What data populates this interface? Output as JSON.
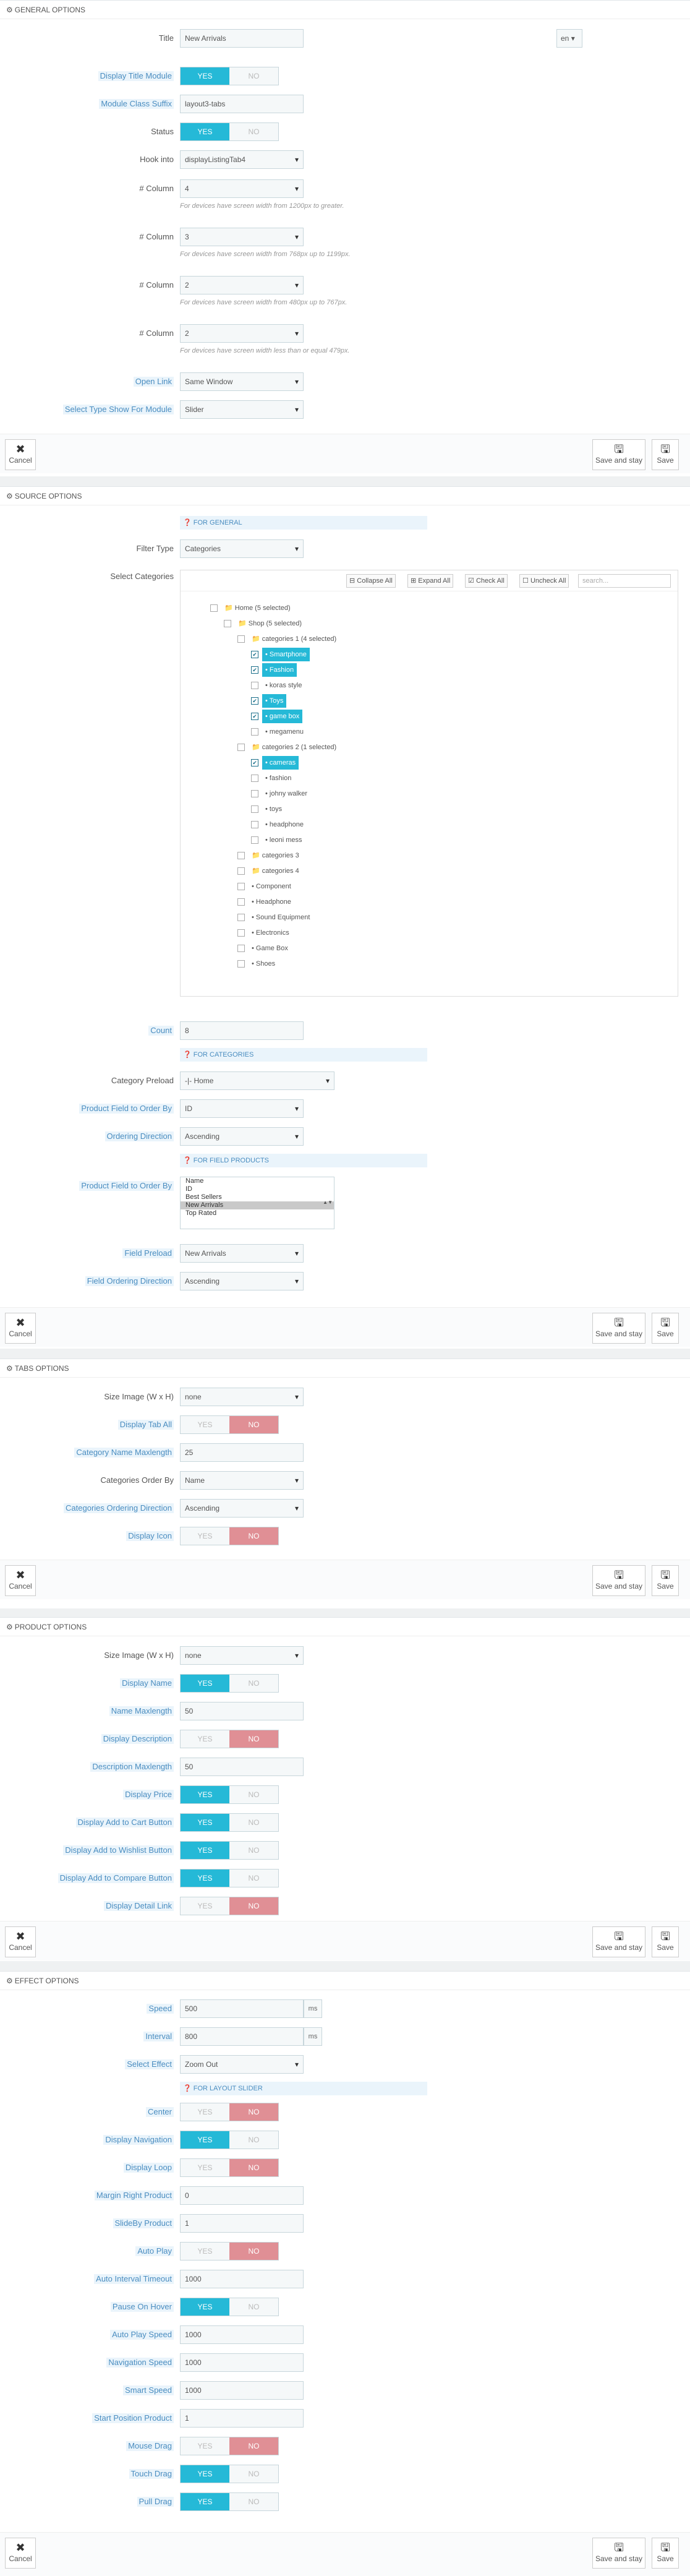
{
  "general": {
    "title": "General Options",
    "fields": {
      "title": "Title",
      "title_value": "New Arrivals",
      "lang": "en",
      "display_title": "Display Title Module",
      "suffix": "Module Class Suffix",
      "suffix_value": "layout3-tabs",
      "status": "Status",
      "hook": "Hook into",
      "hook_value": "displayListingTab4",
      "col1": "# Column",
      "col1_value": "4",
      "col1_help": "For devices have screen width from 1200px to greater.",
      "col2": "# Column",
      "col2_value": "3",
      "col2_help": "For devices have screen width from 768px up to 1199px.",
      "col3": "# Column",
      "col3_value": "2",
      "col3_help": "For devices have screen width from 480px up to 767px.",
      "col4": "# Column",
      "col4_value": "2",
      "col4_help": "For devices have screen width less than or equal 479px.",
      "open_link": "Open Link",
      "open_link_value": "Same Window",
      "type_show": "Select Type Show For Module",
      "type_show_value": "Slider"
    }
  },
  "common": {
    "yes": "YES",
    "no": "NO",
    "cancel": "Cancel",
    "save_stay": "Save and stay",
    "save": "Save"
  },
  "source": {
    "title": "Source Options",
    "for_general": "FOR GENERAL",
    "filter_type": "Filter Type",
    "filter_type_value": "Categories",
    "select_categories": "Select Categories",
    "collapse": "Collapse All",
    "expand": "Expand All",
    "check": "Check All",
    "uncheck": "Uncheck All",
    "search": "search...",
    "tree": [
      "Home (5 selected)",
      "Shop (5 selected)",
      "categories 1 (4 selected)",
      "Smartphone",
      "Fashion",
      "koras style",
      "Toys",
      "game box",
      "megamenu",
      "categories 2 (1 selected)",
      "cameras",
      "fashion",
      "johny walker",
      "toys",
      "headphone",
      "leoni mess",
      "categories 3",
      "categories 4",
      "Component",
      "Headphone",
      "Sound Equipment",
      "Electronics",
      "Game Box",
      "Shoes"
    ],
    "count": "Count",
    "count_value": "8",
    "for_categories": "FOR CATEGORIES",
    "cat_preload": "Category Preload",
    "cat_preload_value": "-|- Home",
    "field_order": "Product Field to Order By",
    "field_order_value": "ID",
    "order_dir": "Ordering Direction",
    "order_dir_value": "Ascending",
    "for_field": "FOR FIELD PRODUCTS",
    "field_order2": "Product Field to Order By",
    "list": [
      "Name",
      "ID",
      "Best Sellers",
      "New Arrivals",
      "Top Rated"
    ],
    "field_preload": "Field Preload",
    "field_preload_value": "New Arrivals",
    "field_order_dir": "Field Ordering Direction",
    "field_order_dir_value": "Ascending"
  },
  "tabs": {
    "title": "Tabs Options",
    "size_image": "Size Image (W x H)",
    "size_image_value": "none",
    "display_tab_all": "Display Tab All",
    "cat_maxlen": "Category Name Maxlength",
    "cat_maxlen_value": "25",
    "cat_order": "Categories Order By",
    "cat_order_value": "Name",
    "cat_order_dir": "Categories Ordering Direction",
    "cat_order_dir_value": "Ascending",
    "display_icon": "Display Icon"
  },
  "product": {
    "title": "Product Options",
    "size_image": "Size Image (W x H)",
    "size_image_value": "none",
    "display_name": "Display Name",
    "name_maxlen": "Name Maxlength",
    "name_maxlen_value": "50",
    "display_desc": "Display Description",
    "desc_maxlen": "Description Maxlength",
    "desc_maxlen_value": "50",
    "display_price": "Display Price",
    "add_cart": "Display Add to Cart Button",
    "add_wish": "Display Add to Wishlist Button",
    "add_compare": "Display Add to Compare Button",
    "detail_link": "Display Detail Link"
  },
  "effect": {
    "title": "Effect Options",
    "speed": "Speed",
    "speed_value": "500",
    "ms": "ms",
    "interval": "Interval",
    "interval_value": "800",
    "effect": "Select Effect",
    "effect_value": "Zoom Out",
    "for_slider": "FOR LAYOUT SLIDER",
    "center": "Center",
    "nav": "Display Navigation",
    "loop": "Display Loop",
    "margin": "Margin Right Product",
    "margin_value": "0",
    "slideby": "SlideBy Product",
    "slideby_value": "1",
    "autoplay": "Auto Play",
    "autotimeout": "Auto Interval Timeout",
    "autotimeout_value": "1000",
    "pause": "Pause On Hover",
    "autospeed": "Auto Play Speed",
    "autospeed_value": "1000",
    "navspeed": "Navigation Speed",
    "navspeed_value": "1000",
    "smart": "Smart Speed",
    "smart_value": "1000",
    "startpos": "Start Position Product",
    "startpos_value": "1",
    "mouse": "Mouse Drag",
    "touch": "Touch Drag",
    "pull": "Pull Drag"
  }
}
